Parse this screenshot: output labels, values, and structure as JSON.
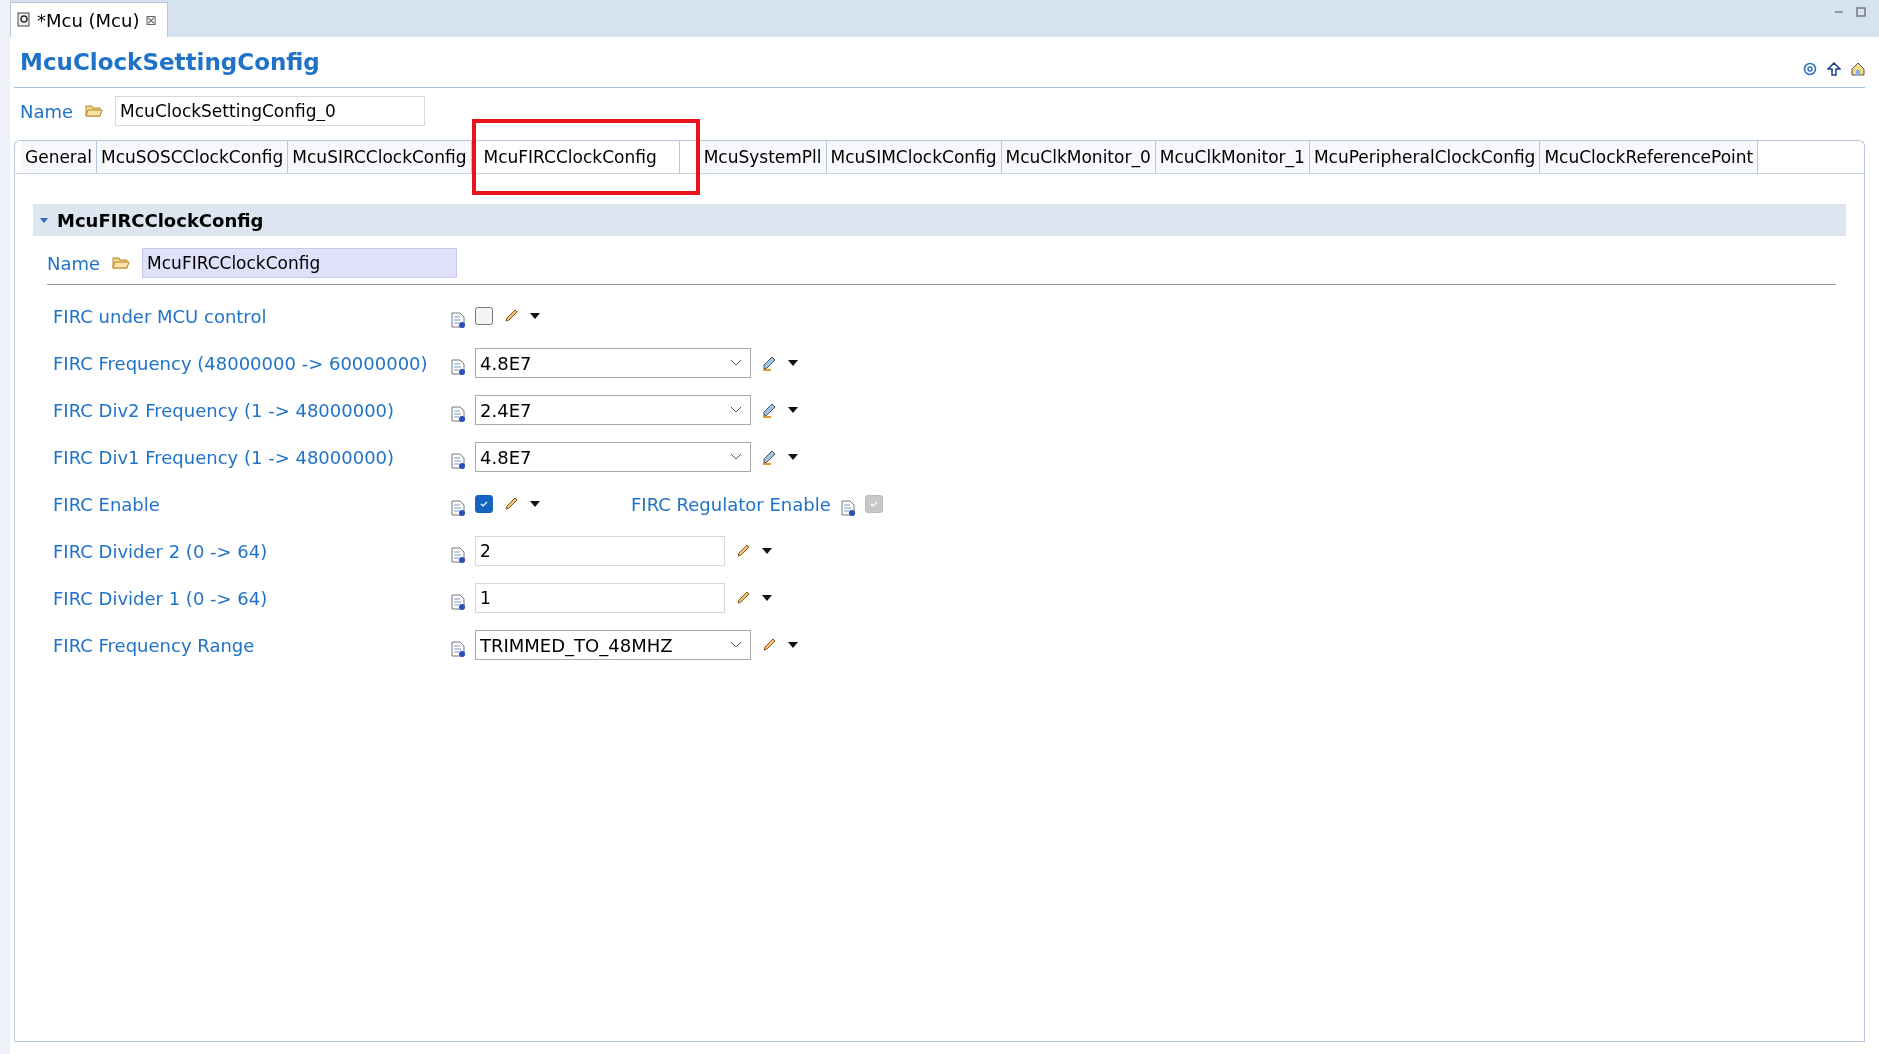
{
  "editor_tab": {
    "title": "*Mcu (Mcu)",
    "close": "⊠"
  },
  "title": "McuClockSettingConfig",
  "name_field": {
    "label": "Name",
    "value": "McuClockSettingConfig_0"
  },
  "tabs": [
    {
      "label": "General",
      "selected": false,
      "highlighted": false
    },
    {
      "label": "McuSOSCClockConfig",
      "selected": false,
      "highlighted": false
    },
    {
      "label": "McuSIRCClockConfig",
      "selected": false,
      "highlighted": false
    },
    {
      "label": "McuFIRCClockConfig",
      "selected": true,
      "highlighted": true
    },
    {
      "label": "McuSystemPll",
      "selected": false,
      "highlighted": false
    },
    {
      "label": "McuSIMClockConfig",
      "selected": false,
      "highlighted": false
    },
    {
      "label": "McuClkMonitor_0",
      "selected": false,
      "highlighted": false
    },
    {
      "label": "McuClkMonitor_1",
      "selected": false,
      "highlighted": false
    },
    {
      "label": "McuPeripheralClockConfig",
      "selected": false,
      "highlighted": false
    },
    {
      "label": "McuClockReferencePoint",
      "selected": false,
      "highlighted": false
    }
  ],
  "section": {
    "title": "McuFIRCClockConfig",
    "expanded": true,
    "name_label": "Name",
    "name_value": "McuFIRCClockConfig",
    "rows": [
      {
        "kind": "checkbox",
        "label": "FIRC under MCU control",
        "checked": false
      },
      {
        "kind": "combo",
        "label": "FIRC Frequency (48000000 -> 60000000)",
        "value": "4.8E7"
      },
      {
        "kind": "combo",
        "label": "FIRC Div2 Frequency (1 -> 48000000)",
        "value": "2.4E7"
      },
      {
        "kind": "combo",
        "label": "FIRC Div1 Frequency (1 -> 48000000)",
        "value": "4.8E7"
      },
      {
        "kind": "checkbox",
        "label": "FIRC Enable",
        "checked": true,
        "extra": {
          "label": "FIRC Regulator Enable",
          "checked": true,
          "disabled": true
        }
      },
      {
        "kind": "text",
        "label": "FIRC Divider 2 (0 -> 64)",
        "value": "2"
      },
      {
        "kind": "text",
        "label": "FIRC Divider 1 (0 -> 64)",
        "value": "1"
      },
      {
        "kind": "enum",
        "label": "FIRC Frequency Range",
        "value": "TRIMMED_TO_48MHZ"
      }
    ]
  }
}
